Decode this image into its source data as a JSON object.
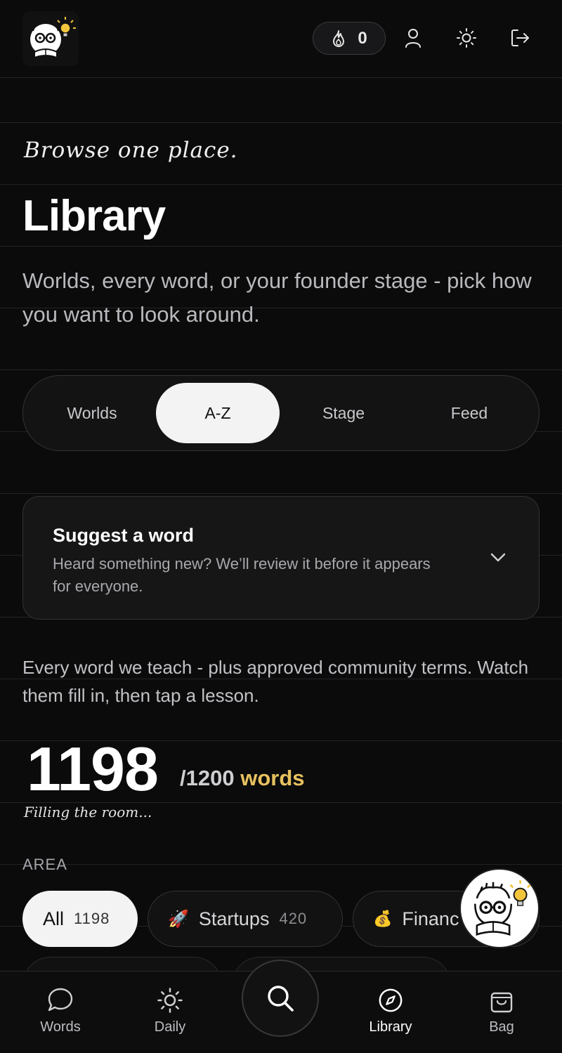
{
  "header": {
    "streak_count": "0",
    "icons": [
      "flame-icon",
      "user-icon",
      "sun-icon",
      "logout-icon"
    ]
  },
  "hero": {
    "tagline": "Browse one place.",
    "title": "Library",
    "subtitle": "Worlds, every word, or your founder stage - pick how you want to look around."
  },
  "segmented": {
    "tabs": [
      {
        "label": "Worlds",
        "active": false
      },
      {
        "label": "A-Z",
        "active": true
      },
      {
        "label": "Stage",
        "active": false
      },
      {
        "label": "Feed",
        "active": false
      }
    ]
  },
  "suggest": {
    "title": "Suggest a word",
    "description": "Heard something new? We’ll review it before it appears for everyone."
  },
  "counter": {
    "intro": "Every word we teach - plus approved community terms. Watch them fill in, then tap a lesson.",
    "count": "1198",
    "total": "/1200",
    "unit": "words",
    "status": "Filling the room..."
  },
  "area": {
    "label": "AREA",
    "chips": [
      {
        "label": "All",
        "count": "1198",
        "emoji": "",
        "active": true
      },
      {
        "label": "Startups",
        "count": "420",
        "emoji": "🚀",
        "active": false
      },
      {
        "label": "Financ",
        "count": "",
        "emoji": "💰",
        "active": false
      }
    ]
  },
  "bottom_nav": {
    "items": [
      {
        "label": "Words",
        "icon": "chat-bubble-icon",
        "active": false
      },
      {
        "label": "Daily",
        "icon": "sun-icon",
        "active": false
      },
      {
        "label": "Library",
        "icon": "compass-icon",
        "active": true
      },
      {
        "label": "Bag",
        "icon": "bag-icon",
        "active": false
      }
    ],
    "fab_icon": "search-icon"
  },
  "colors": {
    "background": "#0b0b0c",
    "accent_gold": "#e7c15f",
    "active_pill": "#f3f3f3"
  }
}
